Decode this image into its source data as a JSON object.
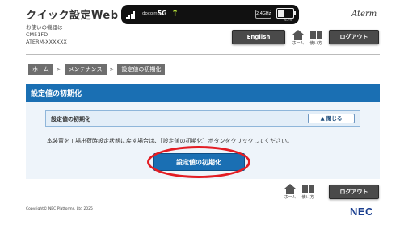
{
  "header": {
    "app_title": "クイック設定Web",
    "device_line1": "お使いの機器は",
    "device_line2": "CM51FD",
    "device_line3": "ATERM-XXXXXX",
    "brand": "Aterm",
    "english_label": "English",
    "home_label": "ホーム",
    "manual_label": "使い方",
    "logout_label": "ログアウト"
  },
  "status_bar": {
    "carrier": "docomo",
    "network": "5G",
    "band": "2.4GHz",
    "battery": "45%"
  },
  "breadcrumb": {
    "home": "ホーム",
    "maintenance": "メンテナンス",
    "current": "設定値の初期化",
    "separator": ">"
  },
  "section": {
    "title": "設定値の初期化",
    "subsection_title": "設定値の初期化",
    "close_label": "閉じる",
    "description": "本装置を工場出荷時設定状態に戻す場合は、［設定値の初期化］ボタンをクリックしてください。",
    "init_button_label": "設定値の初期化"
  },
  "footer": {
    "home_label": "ホーム",
    "manual_label": "使い方",
    "logout_label": "ログアウト",
    "copyright": "Copyright© NEC Platforms, Ltd 2025",
    "logo": "NEC"
  },
  "colors": {
    "accent_blue": "#1a6fb3",
    "highlight_red": "#e31c23"
  }
}
